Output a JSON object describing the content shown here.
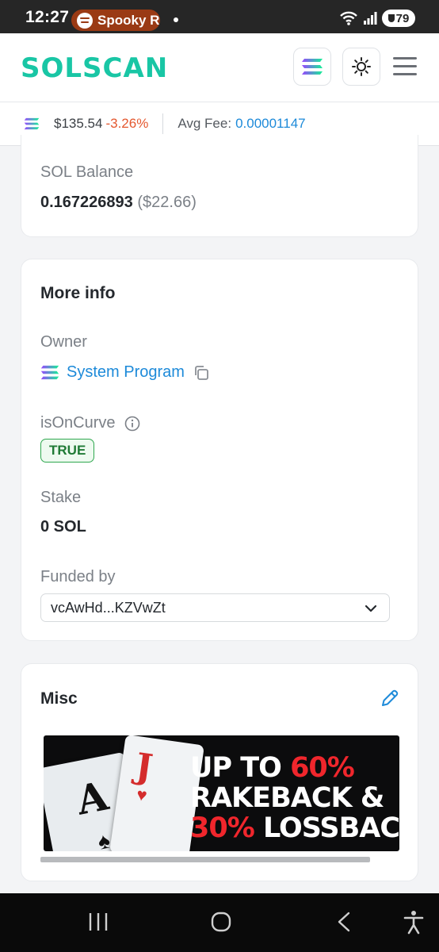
{
  "status_bar": {
    "time": "12:27",
    "media_chip": "Spooky R",
    "battery": "79",
    "icons": [
      "spotify-icon",
      "wifi-icon",
      "signal-icon",
      "battery-icon"
    ]
  },
  "header": {
    "logo": "SOLSCAN",
    "brand_color": "#19c6a5"
  },
  "price_bar": {
    "price": "$135.54",
    "change": "-3.26%",
    "fee_label": "Avg Fee:",
    "fee_value": "0.00001147",
    "change_color": "#e4572e",
    "link_color": "#1d8ad9"
  },
  "balance": {
    "label": "SOL Balance",
    "value": "0.167226893",
    "usd": "($22.66)"
  },
  "more_info": {
    "title": "More info",
    "owner_label": "Owner",
    "owner_value": "System Program",
    "curve_label": "isOnCurve",
    "curve_value": "TRUE",
    "stake_label": "Stake",
    "stake_value": "0 SOL",
    "funded_label": "Funded by",
    "funded_value": "vcAwHd...KZVwZt"
  },
  "misc": {
    "title": "Misc",
    "banner": {
      "line1_a": "UP TO ",
      "line1_b": "60%",
      "line2": "RAKEBACK &",
      "line3_a": "30%",
      "line3_b": " LOSSBAC",
      "card1": "A",
      "card2": "J"
    }
  }
}
